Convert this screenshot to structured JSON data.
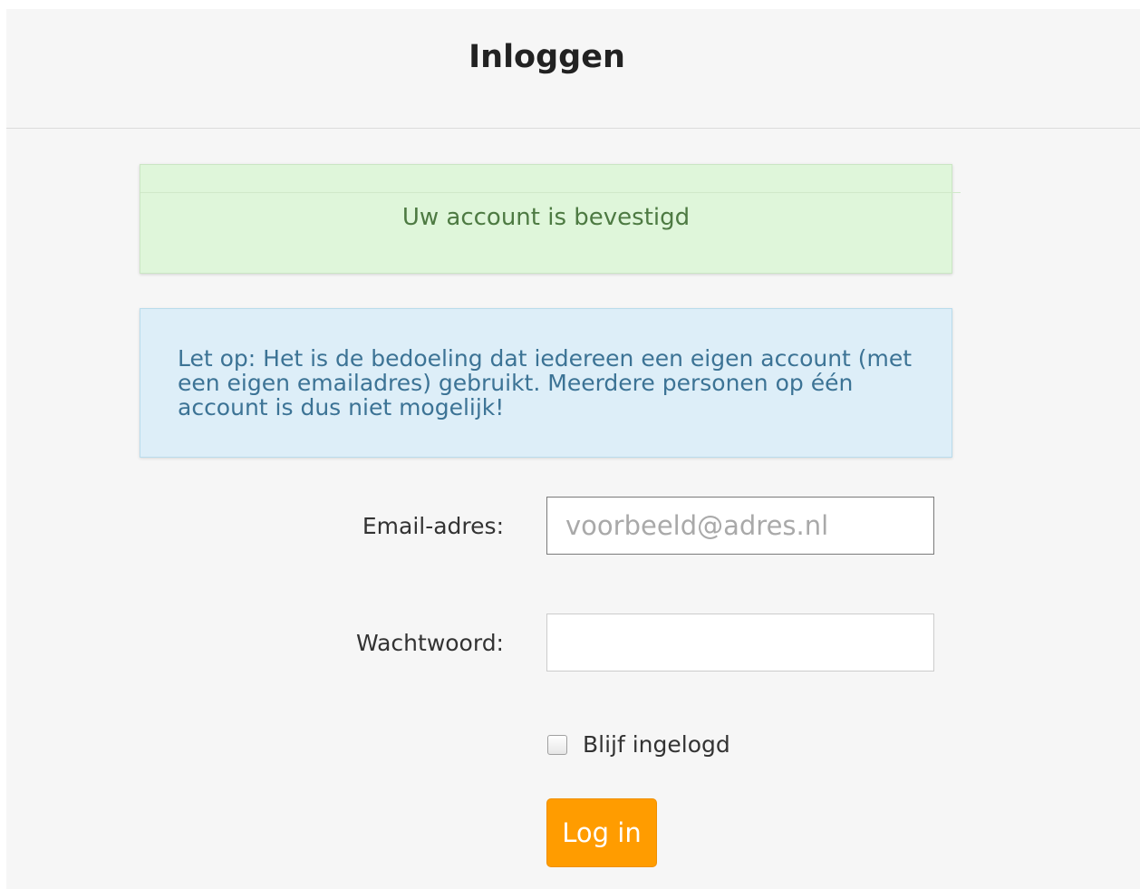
{
  "header": {
    "title": "Inloggen"
  },
  "alerts": {
    "success": "Uw account is bevestigd",
    "info": "Let op: Het is de bedoeling dat iedereen een eigen account (met een eigen emailadres) gebruikt. Meerdere personen op één account is dus niet mogelijk!"
  },
  "form": {
    "email_label": "Email-adres:",
    "email_placeholder": "voorbeeld@adres.nl",
    "email_value": "",
    "password_label": "Wachtwoord:",
    "password_value": "",
    "remember_label": "Blijf ingelogd",
    "remember_checked": false,
    "submit_label": "Log in"
  },
  "colors": {
    "primary_button": "#ff9c00",
    "success_bg": "#dff6da",
    "info_bg": "#ddeef8"
  }
}
